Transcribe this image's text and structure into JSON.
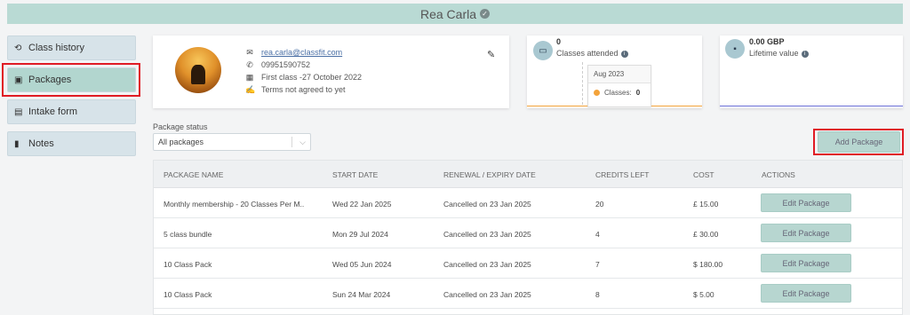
{
  "header": {
    "name": "Rea Carla",
    "verified_icon": "check-circle-icon"
  },
  "sidebar": {
    "items": [
      {
        "label": "Class history",
        "icon": "history-icon"
      },
      {
        "label": "Packages",
        "icon": "id-card-icon"
      },
      {
        "label": "Intake form",
        "icon": "clipboard-icon"
      },
      {
        "label": "Notes",
        "icon": "document-icon"
      }
    ]
  },
  "profile": {
    "email": "rea.carla@classfit.com",
    "phone": "09951590752",
    "first_class": "First class -27 October 2022",
    "terms": "Terms not agreed to yet"
  },
  "stats": {
    "classes_attended_value": "0",
    "classes_attended_label": "Classes attended",
    "tooltip_month": "Aug 2023",
    "tooltip_classes_label": "Classes:",
    "tooltip_classes_value": "0",
    "lifetime_value": "0.00 GBP",
    "lifetime_label": "Lifetime value"
  },
  "filters": {
    "package_status_label": "Package status",
    "package_status_value": "All packages"
  },
  "actions": {
    "add_package": "Add Package"
  },
  "table": {
    "headers": [
      "PACKAGE NAME",
      "START DATE",
      "RENEWAL / EXPIRY DATE",
      "CREDITS LEFT",
      "COST",
      "ACTIONS"
    ],
    "rows": [
      {
        "name": "Monthly membership - 20 Classes Per M..",
        "start": "Wed 22 Jan 2025",
        "expiry": "Cancelled on 23 Jan 2025",
        "credits": "20",
        "cost": "£ 15.00",
        "action": "Edit Package"
      },
      {
        "name": "5 class bundle",
        "start": "Mon 29 Jul 2024",
        "expiry": "Cancelled on 23 Jan 2025",
        "credits": "4",
        "cost": "£ 30.00",
        "action": "Edit Package"
      },
      {
        "name": "10 Class Pack",
        "start": "Wed 05 Jun 2024",
        "expiry": "Cancelled on 23 Jan 2025",
        "credits": "7",
        "cost": "$ 180.00",
        "action": "Edit Package"
      },
      {
        "name": "10 Class Pack",
        "start": "Sun 24 Mar 2024",
        "expiry": "Cancelled on 23 Jan 2025",
        "credits": "8",
        "cost": "$ 5.00",
        "action": "Edit Package"
      }
    ]
  },
  "colors": {
    "accent": "#b7d6d0",
    "highlight": "#e01b24",
    "sidebar": "#d7e3e9"
  }
}
